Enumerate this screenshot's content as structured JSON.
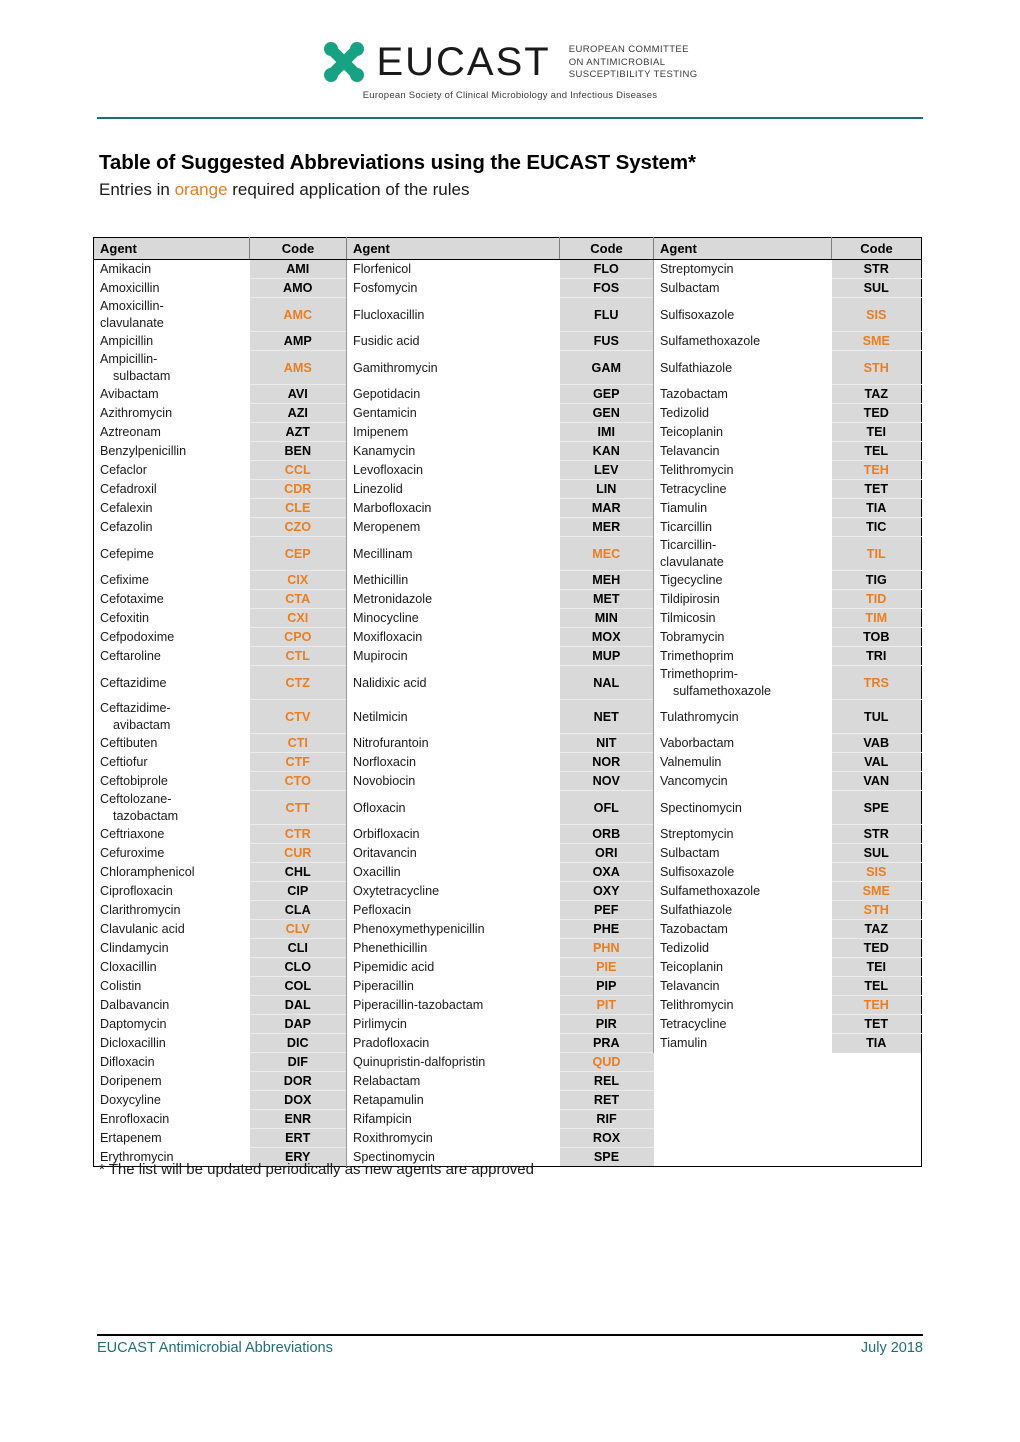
{
  "logo": {
    "wordmark": "EUCAST",
    "committee_line1": "EUROPEAN COMMITTEE",
    "committee_line2": "ON ANTIMICROBIAL",
    "committee_line3": "SUSCEPTIBILITY TESTING",
    "society": "European Society of Clinical Microbiology and Infectious Diseases",
    "mark_color": "#17a383",
    "rule_color": "#1f6f74"
  },
  "title": "Table of Suggested Abbreviations using the EUCAST System*",
  "subtitle": {
    "before": "Entries in ",
    "highlight": "orange",
    "after": " required application of the rules",
    "highlight_color": "#ED7D1F"
  },
  "table": {
    "headers": [
      "Agent",
      "Code",
      "Agent",
      "Code",
      "Agent",
      "Code"
    ],
    "header_bg": "#d9d9d9",
    "code_bg": "#d9d9d9",
    "rows": [
      {
        "a1": "Amikacin",
        "c1": "AMI",
        "o1": false,
        "a2": "Florfenicol",
        "c2": "FLO",
        "o2": false,
        "a3": "Streptomycin",
        "c3": "STR",
        "o3": false
      },
      {
        "a1": "Amoxicillin",
        "c1": "AMO",
        "o1": false,
        "a2": "Fosfomycin",
        "c2": "FOS",
        "o2": false,
        "a3": "Sulbactam",
        "c3": "SUL",
        "o3": false
      },
      {
        "a1": "Amoxicillin-",
        "a1b": "clavulanate",
        "a1indent": false,
        "c1": "AMC",
        "o1": true,
        "a2": "Flucloxacillin",
        "c2": "FLU",
        "o2": false,
        "a3": "Sulfisoxazole",
        "c3": "SIS",
        "o3": true
      },
      {
        "a1": "Ampicillin",
        "c1": "AMP",
        "o1": false,
        "a2": "Fusidic acid",
        "c2": "FUS",
        "o2": false,
        "a3": "Sulfamethoxazole",
        "c3": "SME",
        "o3": true
      },
      {
        "a1": "Ampicillin-",
        "a1b": "sulbactam",
        "a1indent": true,
        "c1": "AMS",
        "o1": true,
        "a2": "Gamithromycin",
        "c2": "GAM",
        "o2": false,
        "a3": "Sulfathiazole",
        "c3": "STH",
        "o3": true
      },
      {
        "a1": "Avibactam",
        "c1": "AVI",
        "o1": false,
        "a2": "Gepotidacin",
        "c2": "GEP",
        "o2": false,
        "a3": "Tazobactam",
        "c3": "TAZ",
        "o3": false
      },
      {
        "a1": "Azithromycin",
        "c1": "AZI",
        "o1": false,
        "a2": "Gentamicin",
        "c2": "GEN",
        "o2": false,
        "a3": "Tedizolid",
        "c3": "TED",
        "o3": false
      },
      {
        "a1": "Aztreonam",
        "c1": "AZT",
        "o1": false,
        "a2": "Imipenem",
        "c2": "IMI",
        "o2": false,
        "a3": "Teicoplanin",
        "c3": "TEI",
        "o3": false
      },
      {
        "a1": "Benzylpenicillin",
        "c1": "BEN",
        "o1": false,
        "a2": "Kanamycin",
        "c2": "KAN",
        "o2": false,
        "a3": "Telavancin",
        "c3": "TEL",
        "o3": false
      },
      {
        "a1": "Cefaclor",
        "c1": "CCL",
        "o1": true,
        "a2": "Levofloxacin",
        "c2": "LEV",
        "o2": false,
        "a3": "Telithromycin",
        "c3": "TEH",
        "o3": true
      },
      {
        "a1": "Cefadroxil",
        "c1": "CDR",
        "o1": true,
        "a2": "Linezolid",
        "c2": "LIN",
        "o2": false,
        "a3": "Tetracycline",
        "c3": "TET",
        "o3": false
      },
      {
        "a1": "Cefalexin",
        "c1": "CLE",
        "o1": true,
        "a2": "Marbofloxacin",
        "c2": "MAR",
        "o2": false,
        "a3": "Tiamulin",
        "c3": "TIA",
        "o3": false
      },
      {
        "a1": "Cefazolin",
        "c1": "CZO",
        "o1": true,
        "a2": "Meropenem",
        "c2": "MER",
        "o2": false,
        "a3": "Ticarcillin",
        "c3": "TIC",
        "o3": false
      },
      {
        "a1": "Cefepime",
        "c1": "CEP",
        "o1": true,
        "a2": "Mecillinam",
        "c2": "MEC",
        "o2": true,
        "a3": "Ticarcillin-",
        "a3b": "clavulanate",
        "a3indent": false,
        "c3": "TIL",
        "o3": true
      },
      {
        "a1": "Cefixime",
        "c1": "CIX",
        "o1": true,
        "a2": "Methicillin",
        "c2": "MEH",
        "o2": false,
        "a3": "Tigecycline",
        "c3": "TIG",
        "o3": false
      },
      {
        "a1": "Cefotaxime",
        "c1": "CTA",
        "o1": true,
        "a2": "Metronidazole",
        "c2": "MET",
        "o2": false,
        "a3": "Tildipirosin",
        "c3": "TID",
        "o3": true
      },
      {
        "a1": "Cefoxitin",
        "c1": "CXI",
        "o1": true,
        "a2": "Minocycline",
        "c2": "MIN",
        "o2": false,
        "a3": "Tilmicosin",
        "c3": "TIM",
        "o3": true
      },
      {
        "a1": "Cefpodoxime",
        "c1": "CPO",
        "o1": true,
        "a2": "Moxifloxacin",
        "c2": "MOX",
        "o2": false,
        "a3": "Tobramycin",
        "c3": "TOB",
        "o3": false
      },
      {
        "a1": "Ceftaroline",
        "c1": "CTL",
        "o1": true,
        "a2": "Mupirocin",
        "c2": "MUP",
        "o2": false,
        "a3": "Trimethoprim",
        "c3": "TRI",
        "o3": false
      },
      {
        "a1": "Ceftazidime",
        "c1": "CTZ",
        "o1": true,
        "a2": "Nalidixic acid",
        "c2": "NAL",
        "o2": false,
        "a3": "Trimethoprim-",
        "a3b": "sulfamethoxazole",
        "a3indent": true,
        "c3": "TRS",
        "o3": true
      },
      {
        "a1": "Ceftazidime-",
        "a1b": "avibactam",
        "a1indent": true,
        "c1": "CTV",
        "o1": true,
        "a2": "Netilmicin",
        "c2": "NET",
        "o2": false,
        "a3": "Tulathromycin",
        "c3": "TUL",
        "o3": false
      },
      {
        "a1": "Ceftibuten",
        "c1": "CTI",
        "o1": true,
        "a2": "Nitrofurantoin",
        "c2": "NIT",
        "o2": false,
        "a3": "Vaborbactam",
        "c3": "VAB",
        "o3": false
      },
      {
        "a1": "Ceftiofur",
        "c1": "CTF",
        "o1": true,
        "a2": "Norfloxacin",
        "c2": "NOR",
        "o2": false,
        "a3": "Valnemulin",
        "c3": "VAL",
        "o3": false
      },
      {
        "a1": "Ceftobiprole",
        "c1": "CTO",
        "o1": true,
        "a2": "Novobiocin",
        "c2": "NOV",
        "o2": false,
        "a3": "Vancomycin",
        "c3": "VAN",
        "o3": false
      },
      {
        "a1": "Ceftolozane-",
        "a1b": "tazobactam",
        "a1indent": true,
        "c1": "CTT",
        "o1": true,
        "a2": "Ofloxacin",
        "c2": "OFL",
        "o2": false,
        "a3": "Spectinomycin",
        "c3": "SPE",
        "o3": false
      },
      {
        "a1": "Ceftriaxone",
        "c1": "CTR",
        "o1": true,
        "a2": "Orbifloxacin",
        "c2": "ORB",
        "o2": false,
        "a3": "Streptomycin",
        "c3": "STR",
        "o3": false
      },
      {
        "a1": "Cefuroxime",
        "c1": "CUR",
        "o1": true,
        "a2": "Oritavancin",
        "c2": "ORI",
        "o2": false,
        "a3": "Sulbactam",
        "c3": "SUL",
        "o3": false
      },
      {
        "a1": "Chloramphenicol",
        "c1": "CHL",
        "o1": false,
        "a2": "Oxacillin",
        "c2": "OXA",
        "o2": false,
        "a3": "Sulfisoxazole",
        "c3": "SIS",
        "o3": true
      },
      {
        "a1": "Ciprofloxacin",
        "c1": "CIP",
        "o1": false,
        "a2": "Oxytetracycline",
        "c2": "OXY",
        "o2": false,
        "a3": "Sulfamethoxazole",
        "c3": "SME",
        "o3": true
      },
      {
        "a1": "Clarithromycin",
        "c1": "CLA",
        "o1": false,
        "a2": "Pefloxacin",
        "c2": "PEF",
        "o2": false,
        "a3": "Sulfathiazole",
        "c3": "STH",
        "o3": true
      },
      {
        "a1": "Clavulanic acid",
        "c1": "CLV",
        "o1": true,
        "a2": "Phenoxymethypenicillin",
        "c2": "PHE",
        "o2": false,
        "a3": "Tazobactam",
        "c3": "TAZ",
        "o3": false
      },
      {
        "a1": "Clindamycin",
        "c1": "CLI",
        "o1": false,
        "a2": "Phenethicillin",
        "c2": "PHN",
        "o2": true,
        "a3": "Tedizolid",
        "c3": "TED",
        "o3": false
      },
      {
        "a1": "Cloxacillin",
        "c1": "CLO",
        "o1": false,
        "a2": "Pipemidic acid",
        "c2": "PIE",
        "o2": true,
        "a3": "Teicoplanin",
        "c3": "TEI",
        "o3": false
      },
      {
        "a1": "Colistin",
        "c1": "COL",
        "o1": false,
        "a2": "Piperacillin",
        "c2": "PIP",
        "o2": false,
        "a3": "Telavancin",
        "c3": "TEL",
        "o3": false
      },
      {
        "a1": "Dalbavancin",
        "c1": "DAL",
        "o1": false,
        "a2": "Piperacillin-tazobactam",
        "c2": "PIT",
        "o2": true,
        "a3": "Telithromycin",
        "c3": "TEH",
        "o3": true
      },
      {
        "a1": "Daptomycin",
        "c1": "DAP",
        "o1": false,
        "a2": "Pirlimycin",
        "c2": "PIR",
        "o2": false,
        "a3": "Tetracycline",
        "c3": "TET",
        "o3": false
      },
      {
        "a1": "Dicloxacillin",
        "c1": "DIC",
        "o1": false,
        "a2": "Pradofloxacin",
        "c2": "PRA",
        "o2": false,
        "a3": "Tiamulin",
        "c3": "TIA",
        "o3": false
      },
      {
        "a1": "Difloxacin",
        "c1": "DIF",
        "o1": false,
        "a2": "Quinupristin-dalfopristin",
        "c2": "QUD",
        "o2": true,
        "a3": "",
        "c3": "",
        "o3": false
      },
      {
        "a1": "Doripenem",
        "c1": "DOR",
        "o1": false,
        "a2": "Relabactam",
        "c2": "REL",
        "o2": false,
        "a3": "",
        "c3": "",
        "o3": false
      },
      {
        "a1": "Doxycyline",
        "c1": "DOX",
        "o1": false,
        "a2": "Retapamulin",
        "c2": "RET",
        "o2": false,
        "a3": "",
        "c3": "",
        "o3": false
      },
      {
        "a1": "Enrofloxacin",
        "c1": "ENR",
        "o1": false,
        "a2": "Rifampicin",
        "c2": "RIF",
        "o2": false,
        "a3": "",
        "c3": "",
        "o3": false
      },
      {
        "a1": "Ertapenem",
        "c1": "ERT",
        "o1": false,
        "a2": "Roxithromycin",
        "c2": "ROX",
        "o2": false,
        "a3": "",
        "c3": "",
        "o3": false
      },
      {
        "a1": "Erythromycin",
        "c1": "ERY",
        "o1": false,
        "a2": "Spectinomycin",
        "c2": "SPE",
        "o2": false,
        "a3": "",
        "c3": "",
        "o3": false
      }
    ]
  },
  "footnote": "* The list will be updated periodically as new agents are approved",
  "footer": {
    "left": "EUCAST Antimicrobial Abbreviations",
    "right": "July 2018",
    "color": "#1f6f74"
  }
}
